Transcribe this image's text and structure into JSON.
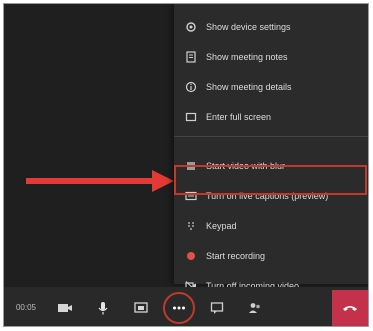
{
  "menu": {
    "items": [
      {
        "label": "Show device settings",
        "icon": "gear-icon"
      },
      {
        "label": "Show meeting notes",
        "icon": "notes-icon"
      },
      {
        "label": "Show meeting details",
        "icon": "info-icon"
      },
      {
        "label": "Enter full screen",
        "icon": "fullscreen-icon"
      },
      {
        "label": "Start video with blur",
        "icon": "blur-icon"
      },
      {
        "label": "Turn on live captions (preview)",
        "icon": "captions-icon"
      },
      {
        "label": "Keypad",
        "icon": "keypad-icon"
      },
      {
        "label": "Start recording",
        "icon": "record-icon"
      },
      {
        "label": "Turn off incoming video",
        "icon": "video-off-icon"
      }
    ]
  },
  "toolbar": {
    "timer": "00:05"
  },
  "colors": {
    "accent_red": "#c0392b",
    "hangup_red": "#c4314b",
    "record_red": "#e0524a"
  }
}
